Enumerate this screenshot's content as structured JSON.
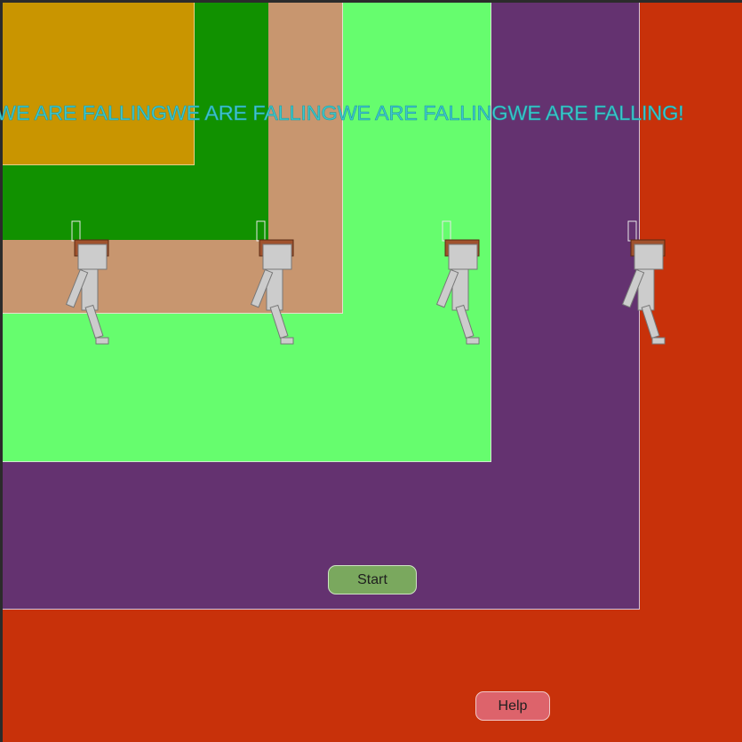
{
  "banner": {
    "text": "WE ARE FALLINGWE ARE FALLINGWE ARE FALLINGWE ARE FALLING!"
  },
  "buttons": {
    "start_label": "Start",
    "help_label": "Help"
  },
  "colors": {
    "frame": "#2b2b2b",
    "layer_red": "#c8310a",
    "layer_purple": "#643270",
    "layer_lime": "#66fd6e",
    "layer_tan": "#c8966f",
    "layer_green": "#119100",
    "layer_gold": "#c99500",
    "banner_text": "#3fc7cc",
    "start_button": "#7aa85e",
    "help_button": "#dd636b",
    "figure_body": "#cccccc",
    "figure_hat": "#a0522d"
  },
  "characters": [
    {
      "name": "walker-1"
    },
    {
      "name": "walker-2"
    },
    {
      "name": "walker-3"
    },
    {
      "name": "walker-4"
    }
  ]
}
